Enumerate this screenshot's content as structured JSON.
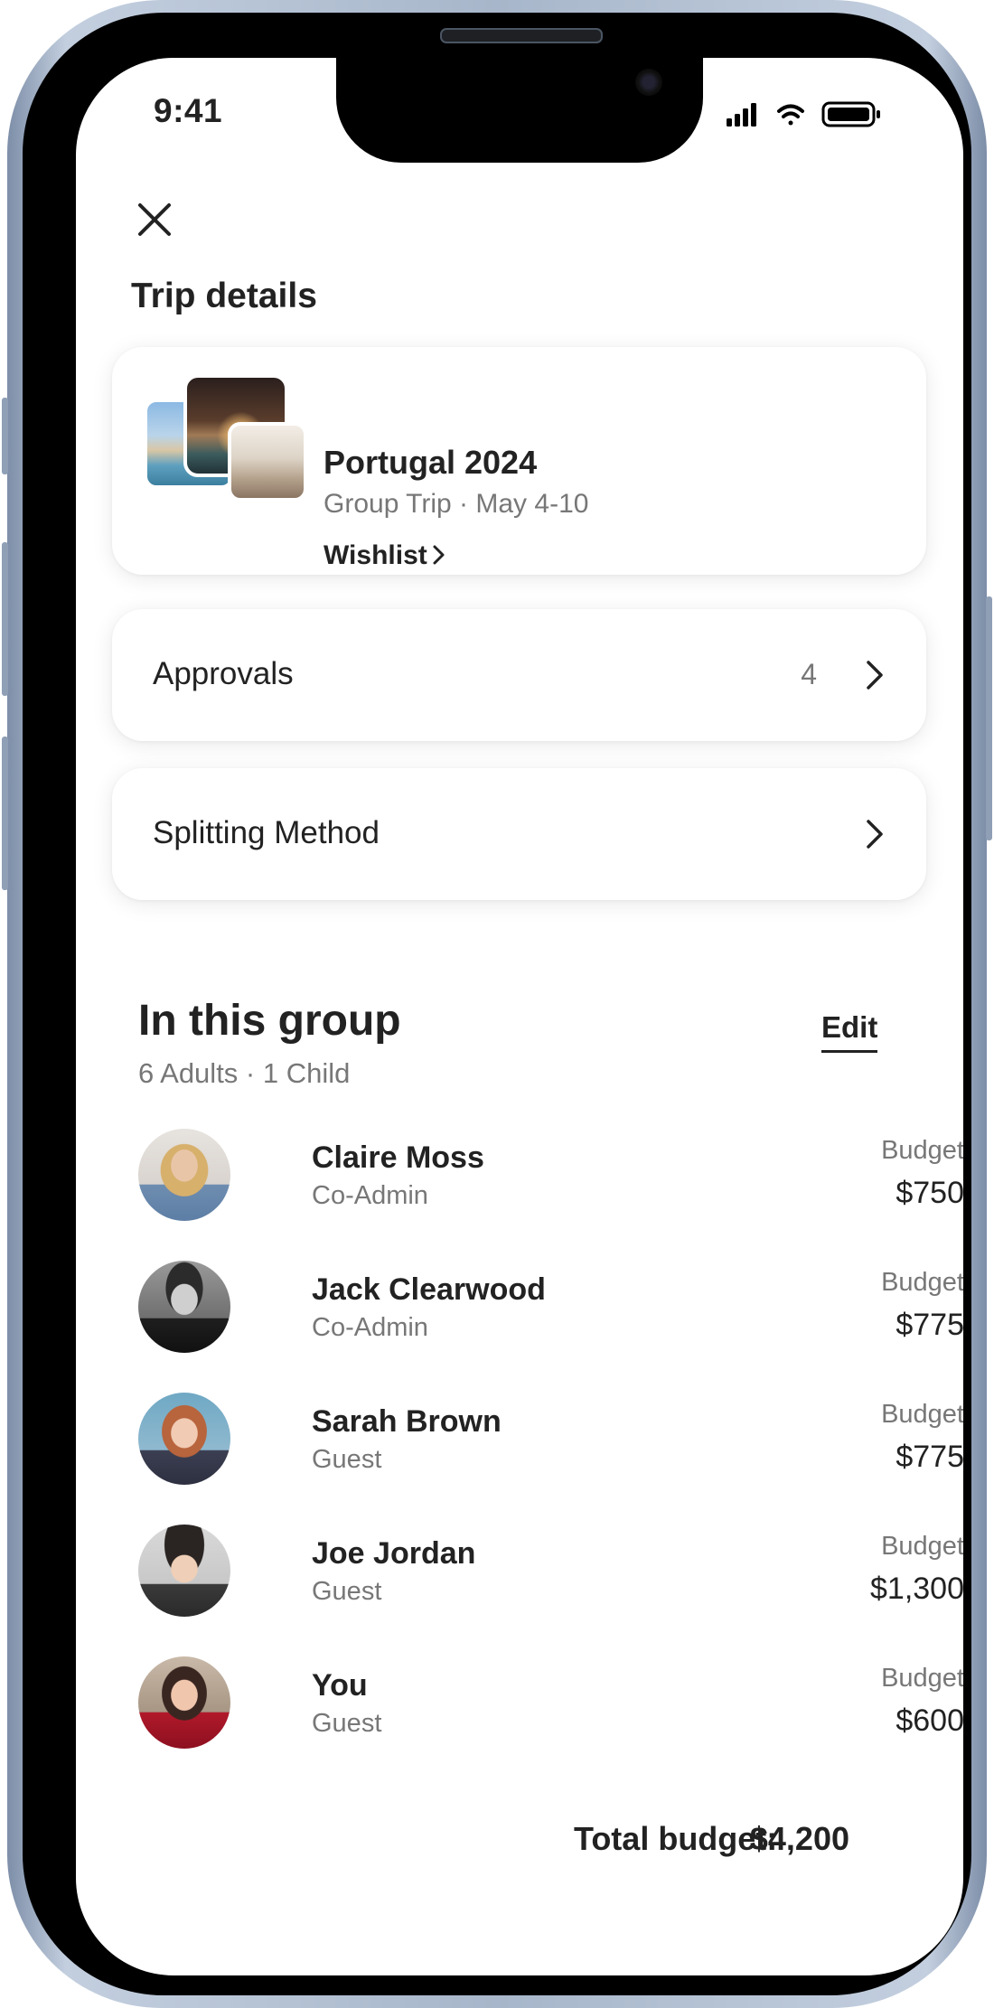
{
  "status_bar": {
    "time": "9:41"
  },
  "header": {
    "title": "Trip details"
  },
  "trip": {
    "name": "Portugal 2024",
    "subtitle": "Group Trip · May 4-10",
    "wishlist_label": "Wishlist"
  },
  "rows": {
    "approvals": {
      "label": "Approvals",
      "count": "4"
    },
    "splitting": {
      "label": "Splitting Method"
    }
  },
  "group": {
    "title": "In this group",
    "subtitle": "6 Adults · 1 Child",
    "edit_label": "Edit",
    "budget_label": "Budget",
    "members": [
      {
        "name": "Claire Moss",
        "role": "Co-Admin",
        "budget": "$750"
      },
      {
        "name": "Jack Clearwood",
        "role": "Co-Admin",
        "budget": "$775"
      },
      {
        "name": "Sarah Brown",
        "role": "Guest",
        "budget": "$775"
      },
      {
        "name": "Joe Jordan",
        "role": "Guest",
        "budget": "$1,300"
      },
      {
        "name": "You",
        "role": "Guest",
        "budget": "$600"
      }
    ],
    "total_label": "Total budget:",
    "total_value": "$4,200"
  },
  "icons": {
    "close": "close-icon",
    "chevron": "chevron-right-icon",
    "signal": "cellular-signal-icon",
    "wifi": "wifi-icon",
    "battery": "battery-icon"
  }
}
